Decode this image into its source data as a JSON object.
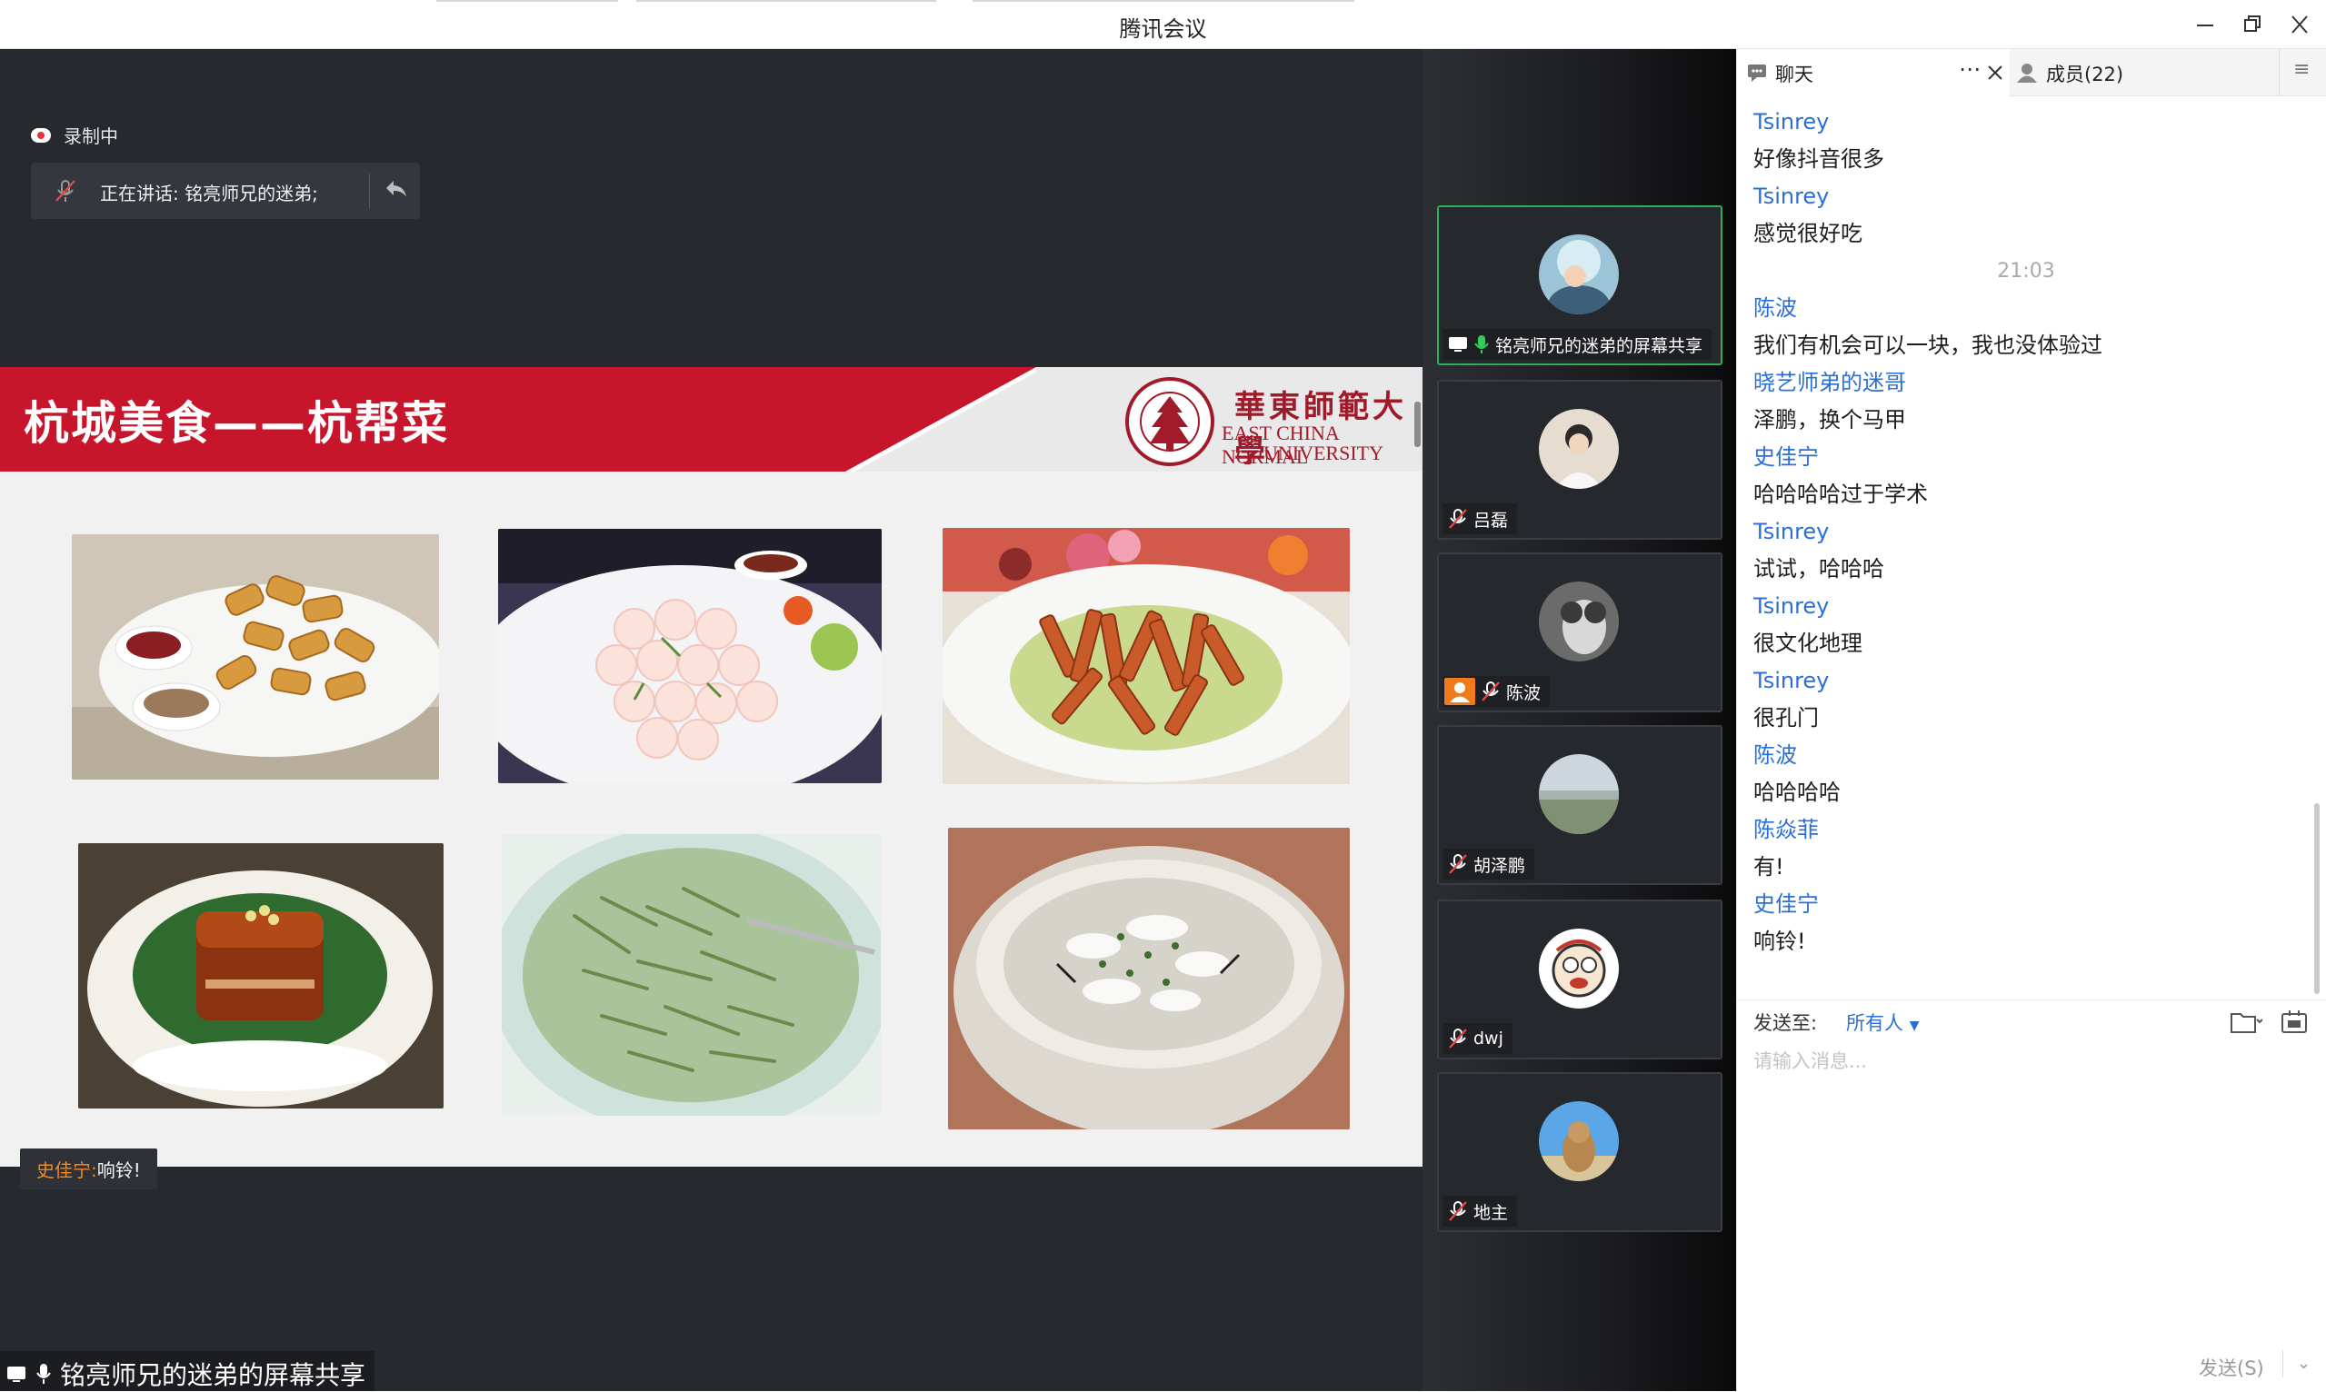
{
  "window": {
    "title": "腾讯会议"
  },
  "stage": {
    "recording_label": "录制中",
    "speaking_label": "正在讲话: 铭亮师兄的迷弟;",
    "slide": {
      "title": "杭城美食——杭帮菜",
      "university_cn": "華東師範大學",
      "university_en_line1": "EAST CHINA NORMAL",
      "university_en_line2": "UNIVERSITY",
      "foods": [
        "fried-tofu-skin-rolls",
        "shrimp-with-longjing-tea",
        "braised-bamboo-shoots",
        "dongpo-pork",
        "tea-leaf-soup",
        "west-lake-fish-soup"
      ]
    },
    "subtitle": {
      "speaker": "史佳宁:",
      "text": "响铃!"
    },
    "share_label": "铭亮师兄的迷弟的屏幕共享"
  },
  "participants": [
    {
      "name": "铭亮师兄的迷弟的屏幕共享",
      "icon": "mic-on-icon",
      "active": true
    },
    {
      "name": "吕磊",
      "icon": "mic-muted-icon"
    },
    {
      "name": "陈波",
      "icon": "mic-muted-icon"
    },
    {
      "name": "胡泽鹏",
      "icon": "mic-muted-icon"
    },
    {
      "name": "dwj",
      "icon": "mic-muted-icon"
    },
    {
      "name": "地主",
      "icon": "mic-muted-icon"
    }
  ],
  "chat": {
    "tab_chat": "聊天",
    "tab_members": "成员(22)",
    "messages": [
      {
        "sender": "Tsinrey",
        "text": "好像抖音很多"
      },
      {
        "sender": "Tsinrey",
        "text": "感觉很好吃"
      },
      {
        "time": "21:03"
      },
      {
        "sender": "陈波",
        "text": "我们有机会可以一块，我也没体验过"
      },
      {
        "sender": "晓艺师弟的迷哥",
        "text": "泽鹏，换个马甲"
      },
      {
        "sender": "史佳宁",
        "text": "哈哈哈哈过于学术"
      },
      {
        "sender": "Tsinrey",
        "text": "试试，哈哈哈"
      },
      {
        "sender": "Tsinrey",
        "text": "很文化地理"
      },
      {
        "sender": "Tsinrey",
        "text": "很孔门"
      },
      {
        "sender": "陈波",
        "text": "哈哈哈哈"
      },
      {
        "sender": "陈焱菲",
        "text": "有!"
      },
      {
        "sender": "史佳宁",
        "text": "响铃!"
      }
    ],
    "send_to_label": "发送至:",
    "send_to_value": "所有人",
    "input_placeholder": "请输入消息...",
    "send_button": "发送(S)"
  },
  "colors": {
    "accent_blue": "#2b6fd6",
    "slide_red": "#c7162b",
    "active_green": "#2fae5a",
    "caption_orange": "#f08a24"
  }
}
